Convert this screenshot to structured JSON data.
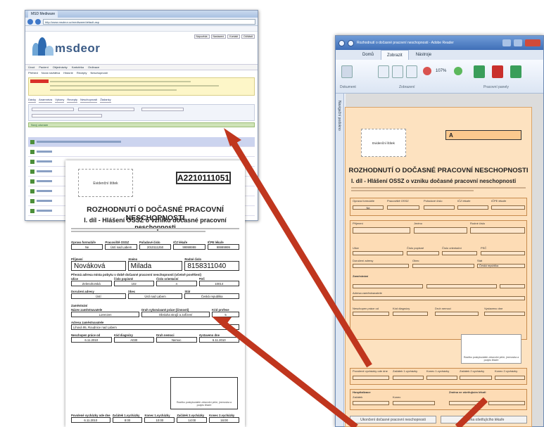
{
  "browser": {
    "tab_title": "MSD Mediware",
    "address": "http://www.msdeor.cz/mediware/default.asp",
    "logo_text": "msdeor",
    "top_links": [
      "Nápověda",
      "Nastavení",
      "Kontakt",
      "Odhlásit"
    ],
    "menu": [
      "Úvod",
      "Pacient",
      "Objednávky",
      "Kartotéka",
      "Ordinace"
    ],
    "submenu": [
      "Přehled",
      "Nová návštěva",
      "Historie",
      "Recepty",
      "Neschopnosti"
    ],
    "tabs": [
      "Dávky",
      "Anamnéza",
      "Výkony",
      "Recepty",
      "Neschopnosti",
      "Žádanky"
    ],
    "green_bar": "Nový záznam"
  },
  "paper_form": {
    "stamp_label": "Evidenční štítek",
    "form_code": "A2210111051",
    "title": "ROZHODNUTÍ O DOČASNÉ PRACOVNÍ NESCHOPNOSTI",
    "subtitle": "I. díl - Hlášení OSSZ o vzniku dočasné pracovní neschopnosti",
    "row1_labels": [
      "Oprava formuláře",
      "Pracoviště OSSZ",
      "Pořadové číslo",
      "IČZ lékaře",
      "IČPE lékaře"
    ],
    "row1_values": [
      "Ne",
      "Ústí nad Labem",
      "2010111250",
      "99999999",
      "99999999"
    ],
    "name_labels": [
      "Příjmení",
      "Jméno",
      "Rodné číslo"
    ],
    "name_values": [
      "Nováková",
      "Milada",
      "8158311040"
    ],
    "address_heading": "Přesná adresa místa pobytu v době dočasné pracovní neschopnosti (včetně pověšení)",
    "address_labels": [
      "Ulice",
      "Číslo popisné",
      "Číslo orientační",
      "PSČ"
    ],
    "address_values": [
      "Zelenohorská",
      "102",
      "4",
      "10014"
    ],
    "city_labels": [
      "Doručení adresy",
      "Obec",
      "Stát"
    ],
    "city_values": [
      "Ústí",
      "Ústí nad Labem",
      "Česká republika"
    ],
    "employer_heading": "Zaměstnání",
    "employer_labels": [
      "Název zaměstnavatele",
      "Druh vykonávané práce (činnosti)",
      "Kód profese"
    ],
    "employer_values": [
      "Lorenzen",
      "Obsluha strojů a zařízení",
      "5"
    ],
    "employer_address_label": "Adresa zaměstnavatele",
    "employer_address": "Lihová 95, Roudnice nad Labem",
    "bottom_labels": [
      "Neschopen práce od",
      "Kód diagnózy",
      "Druh nemoci",
      "Vystaveno dne"
    ],
    "bottom_values": [
      "6.11.2010",
      "A030",
      "Nemoc",
      "6.11.2010"
    ],
    "signature_caption": "Razítko poskytovatele zdravotní péče, jmenovka a podpis lékaře",
    "outing_labels": [
      "Povolené vycházky ode dne",
      "Začátek 1.vycházky",
      "Konec 1.vycházky",
      "Začátek 2.vycházky",
      "Konec 2.vycházky"
    ],
    "outing_values": [
      "6.11.2010",
      "8:00",
      "10:00",
      "14:00",
      "16:00"
    ]
  },
  "pdf_window": {
    "title": "Rozhodnutí o dočasné pracovní neschopnosti - Adobe Reader",
    "zoom": "107%",
    "tabs": [
      "Domů",
      "Zobrazit",
      "Nástroje"
    ],
    "ribbon_groups": [
      "Dokument",
      "Zobrazení",
      "Pracovní panely"
    ],
    "side_label": "Navigační podokno",
    "form": {
      "stamp_label": "Evidenční štítek",
      "form_code": "A",
      "title": "ROZHODNUTÍ O DOČASNÉ PRACOVNÍ NESCHOPNOSTI",
      "subtitle": "I. díl - Hlášení OSSZ o vzniku dočasné pracovní neschopnosti",
      "row1_labels": [
        "Oprava formuláře",
        "Pracoviště OSSZ",
        "Pořadové číslo",
        "IČZ lékaře",
        "IČPE lékaře"
      ],
      "row1_value": "Ne",
      "name_labels": [
        "Příjmení",
        "Jméno",
        "Rodné číslo"
      ],
      "address_labels": [
        "Ulice",
        "Číslo popisné",
        "Číslo orientační",
        "PSČ"
      ],
      "city_labels": [
        "Doručení adresy",
        "Obec",
        "Stát"
      ],
      "state_value": "Česká republika",
      "employer_heading": "Zaměstnání",
      "employer_address_label": "Adresa zaměstnavatele",
      "bottom_labels": [
        "Neschopen práce od",
        "Kód diagnózy",
        "Druh nemoci",
        "Vystaveno dne"
      ],
      "signature_caption": "Razítko poskytovatele zdravotní péče, jmenovka a podpis lékaře",
      "outing_labels": [
        "Povolené vycházky ode dne",
        "Začátek 1.vycházky",
        "Konec 1.vycházky",
        "Začátek 2.vycházky",
        "Konec 2.vycházky"
      ],
      "hospital_labels": [
        "Hospitalizace",
        "Začátek",
        "Konec"
      ],
      "change_labels": [
        "Změna ve ošetřujícím lékaři"
      ],
      "buttons": [
        "Ukončení dočasné pracovní neschopnosti",
        "Změna ošetřujícího lékaře"
      ]
    }
  },
  "colors": {
    "arrow": "#c0361e",
    "form_orange": "#fde2c0"
  }
}
